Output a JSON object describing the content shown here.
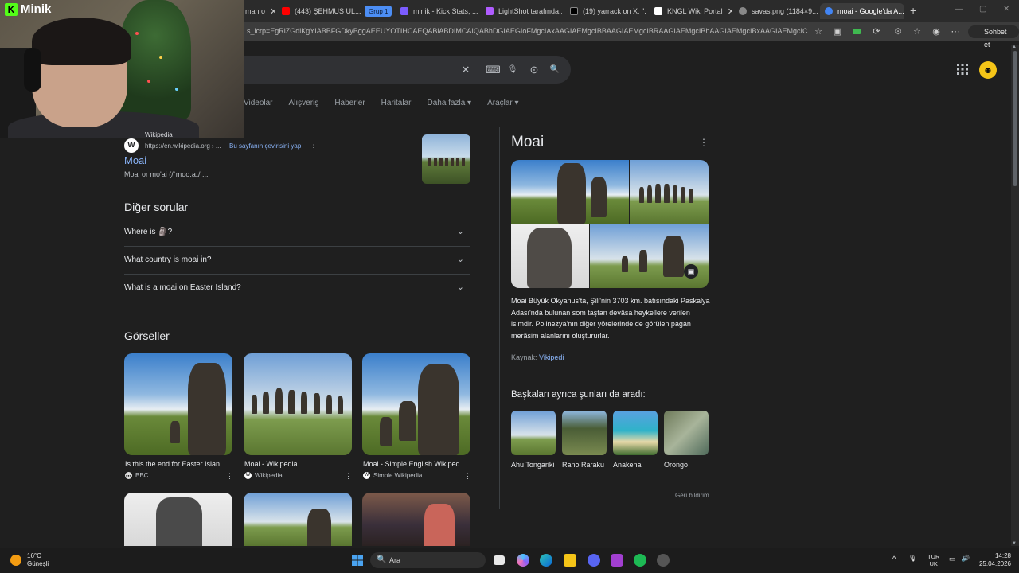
{
  "browser": {
    "tabs": [
      {
        "label": "man o",
        "color": "#555"
      },
      {
        "label": "(443) ŞEHMUS UL...",
        "color": "#ff0000"
      },
      {
        "label": "minik - Kick Stats, ...",
        "color": "#7b5cff"
      },
      {
        "label": "LightShot tarafında...",
        "color": "#b05cff"
      },
      {
        "label": "(19) yarrack on X: \"...",
        "color": "#000000"
      },
      {
        "label": "KNGL Wiki Portal",
        "color": "#ffffff"
      },
      {
        "label": "savas.png (1184×9...",
        "color": "#888888"
      },
      {
        "label": "moai - Google'da A...",
        "color": "#4285f4"
      }
    ],
    "group_label": "Grup 1",
    "close_glyph": "✕",
    "newtab_glyph": "+",
    "window_controls": [
      "—",
      "▢",
      "✕"
    ],
    "url": "s_lcrp=EgRlZGdlKgYIABBFGDkyBggAEEUYOTIHCAEQABiABDIMCAIQABhDGIAEGIoFMgcIAxAAGIAEMgcIBBAAGIAEMgcIBRAAGIAEMgcIBhAAGIAEMgcIBxAAGIAEMgcICBAA...",
    "toolbar_icons": [
      "☆",
      "▣",
      "▭",
      "⟳",
      "⚙",
      "☆",
      "◉",
      "⋯"
    ],
    "sohbet_label": "Sohbet et"
  },
  "overlay": {
    "brand_letter": "K",
    "brand_name": "Minik"
  },
  "search": {
    "clear_glyph": "✕",
    "keyboard_glyph": "⌨",
    "mic_glyph": "🎙",
    "lens_glyph": "⊙",
    "search_glyph": "🔍",
    "apps_glyph": "⋮⋮⋮",
    "avatar_glyph": "☻"
  },
  "navtabs": [
    "Videolar",
    "Alışveriş",
    "Haberler",
    "Haritalar",
    "Daha fazla ▾",
    "Araçlar ▾"
  ],
  "result": {
    "icon_letter": "W",
    "site": "Wikipedia",
    "cite": "https://en.wikipedia.org › ...",
    "translate": "Bu sayfanın çevirisini yap",
    "more_glyph": "⋮",
    "title": "Moai",
    "snippet": "Moai or mo'ai (/ˈmoʊ.aɪ/ ..."
  },
  "faq": {
    "heading": "Diğer sorular",
    "chevron": "⌄",
    "questions": [
      "Where is 🗿?",
      "What country is moai in?",
      "What is a moai on Easter Island?"
    ]
  },
  "images": {
    "heading": "Görseller",
    "more_glyph": "⋮",
    "items": [
      {
        "caption": "Is this the end for Easter Islan...",
        "source": "BBC",
        "src_icon": "●●●"
      },
      {
        "caption": "Moai - Wikipedia",
        "source": "Wikipedia",
        "src_icon": "W"
      },
      {
        "caption": "Moai - Simple English Wikiped...",
        "source": "Simple Wikipedia",
        "src_icon": "W"
      }
    ]
  },
  "knowledge_panel": {
    "title": "Moai",
    "more_glyph": "⋮",
    "gallery_glyph": "▣",
    "description": "Moai Büyük Okyanus'ta, Şili'nin 3703 km. batısındaki Paskalya Adası'nda bulunan som taştan devâsa heykellere verilen isimdir. Polinezya'nın diğer yörelerinde de görülen pagan merâsim alanlarını oluştururlar.",
    "source_label": "Kaynak:",
    "source_link": "Vikipedi",
    "also_heading": "Başkaları ayrıca şunları da aradı:",
    "related": [
      "Ahu Tongariki",
      "Rano Raraku",
      "Anakena",
      "Orongo"
    ],
    "feedback": "Geri bildirim"
  },
  "scrollbar": {
    "up": "▲",
    "down": "▼"
  },
  "taskbar": {
    "weather_temp": "16°C",
    "weather_desc": "Güneşli",
    "search_glyph": "🔍",
    "search_placeholder": "Ara",
    "tray_icons": [
      "^",
      "🎙",
      "▭",
      "🔊"
    ],
    "lang_1": "TUR",
    "lang_2": "UK",
    "time": "14:28",
    "date": "25.04.2026"
  }
}
